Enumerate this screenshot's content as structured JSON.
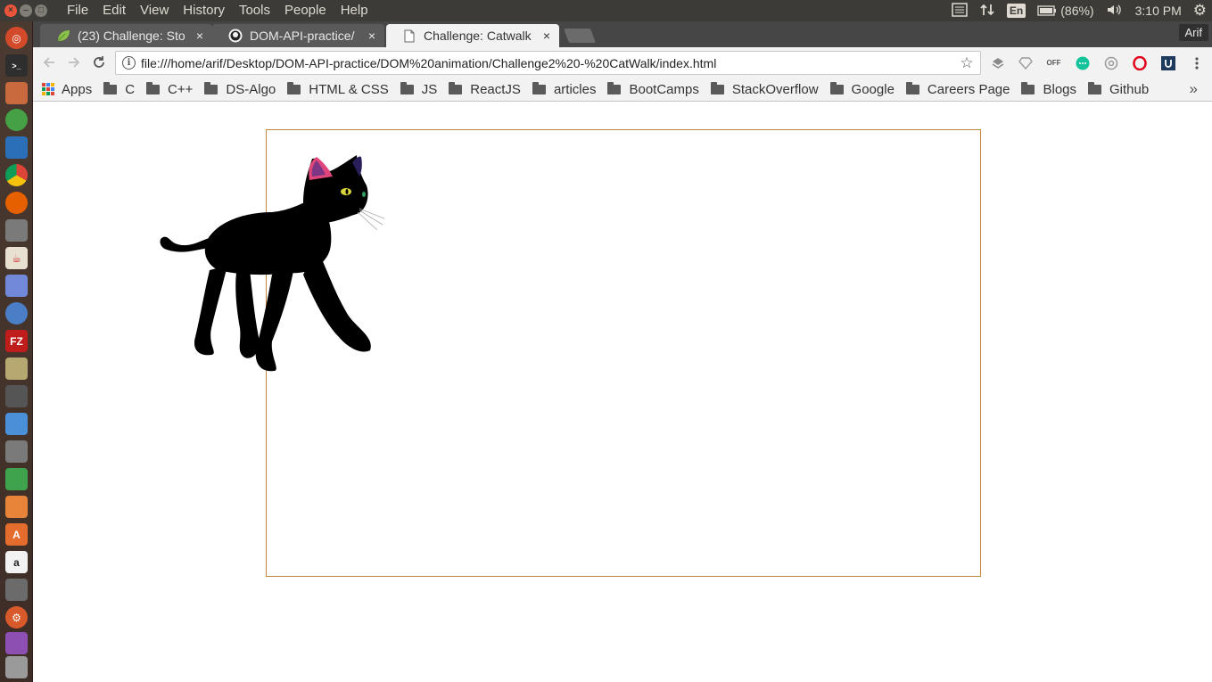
{
  "panel": {
    "menus": [
      "File",
      "Edit",
      "View",
      "History",
      "Tools",
      "People",
      "Help"
    ],
    "keyboard": "En",
    "battery": "(86%)",
    "time": "3:10 PM"
  },
  "tabs": [
    {
      "title": "(23) Challenge: Sto",
      "icon": "leaf-icon",
      "close": "×"
    },
    {
      "title": "DOM-API-practice/",
      "icon": "github-icon",
      "close": "×"
    },
    {
      "title": "Challenge: Catwalk",
      "icon": "page-icon",
      "close": "×"
    }
  ],
  "profile": "Arif",
  "omnibox": {
    "url": "file:///home/arif/Desktop/DOM-API-practice/DOM%20animation/Challenge2%20-%20CatWalk/index.html",
    "info": "i"
  },
  "bookmarks": {
    "apps_label": "Apps",
    "folders": [
      "C",
      "C++",
      "DS-Algo",
      "HTML & CSS",
      "JS",
      "ReactJS",
      "articles",
      "BootCamps",
      "StackOverflow",
      "Google",
      "Careers Page",
      "Blogs",
      "Github"
    ]
  },
  "colors": {
    "panel": "#3c3b37",
    "tabstrip": "#464646",
    "toolbar": "#f2f2f2",
    "stage_border": "#c0883a"
  }
}
